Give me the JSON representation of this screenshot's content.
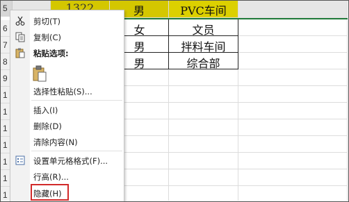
{
  "rows": {
    "headers": [
      "5",
      "6",
      "7",
      "8",
      "9",
      "1",
      "1",
      "1",
      "1",
      "1",
      "1",
      "1"
    ]
  },
  "table": {
    "row5": {
      "name": "1322",
      "gender": "男",
      "dept": "PVC车间"
    },
    "row6": {
      "gender": "女",
      "dept": "文员"
    },
    "row7": {
      "gender": "男",
      "dept": "拌料车间"
    },
    "row8": {
      "gender": "男",
      "dept": "综合部"
    }
  },
  "context_menu": {
    "cut": "剪切(T)",
    "copy": "复制(C)",
    "paste_options": "粘贴选项:",
    "paste_special": "选择性粘贴(S)...",
    "insert": "插入(I)",
    "delete": "删除(D)",
    "clear_contents": "清除内容(N)",
    "format_cells": "设置单元格格式(F)...",
    "row_height": "行高(R)...",
    "hide": "隐藏(H)"
  },
  "colors": {
    "header_yellow": "#d4c700",
    "highlight_box": "#d12a2a"
  }
}
